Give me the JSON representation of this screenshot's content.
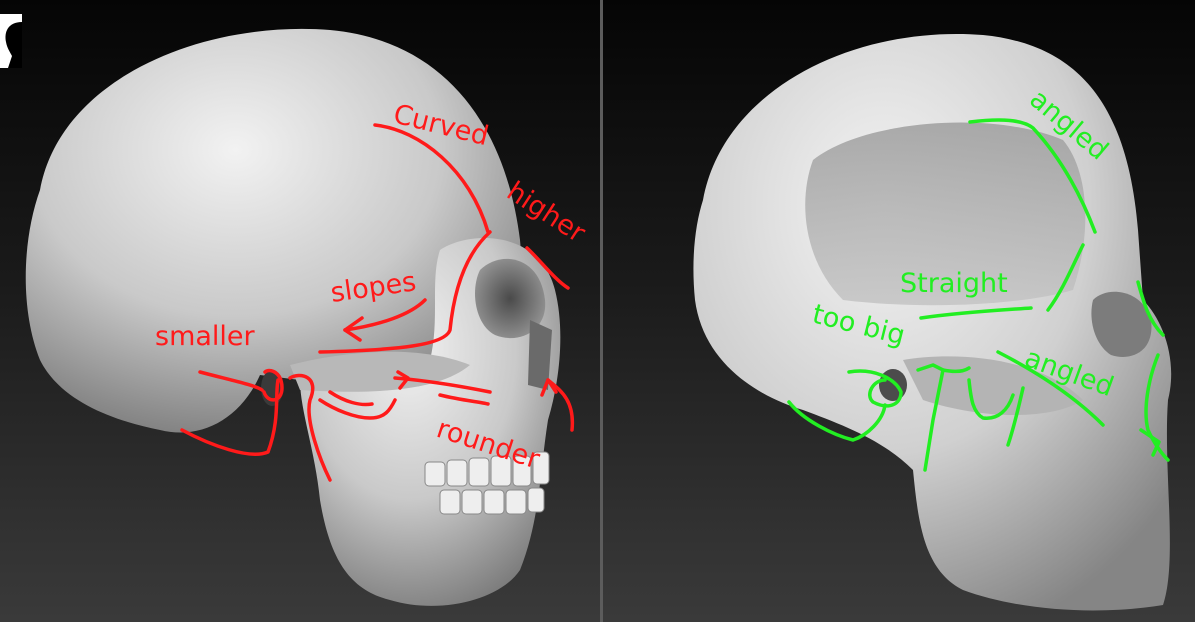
{
  "left_panel": {
    "annotations": {
      "curved": "Curved",
      "higher": "higher",
      "slopes": "slopes",
      "smaller": "smaller",
      "rounder": "rounder"
    },
    "annotation_color": "#ff1a1a"
  },
  "right_panel": {
    "annotations": {
      "angled_top": "angled",
      "straight": "Straight",
      "too_big": "too big",
      "angled_bottom": "angled"
    },
    "annotation_color": "#22ee22"
  },
  "icons": {
    "reference_badge": "head-silhouette-icon"
  }
}
